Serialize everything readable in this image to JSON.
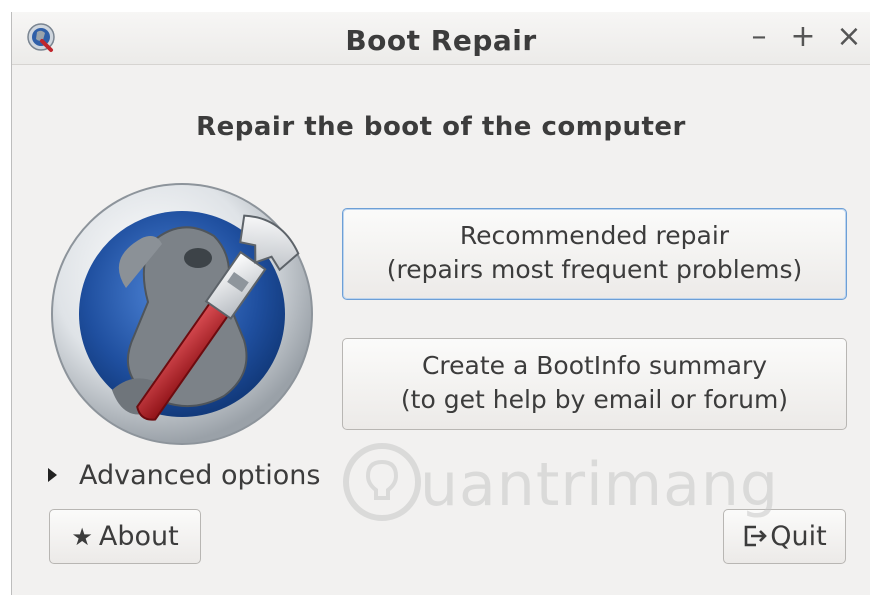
{
  "window": {
    "title": "Boot Repair",
    "controls": {
      "minimize": "–",
      "maximize": "+",
      "close": "×"
    }
  },
  "main": {
    "heading": "Repair the boot of the computer",
    "recommended_repair": {
      "line1": "Recommended repair",
      "line2": "(repairs most frequent problems)"
    },
    "bootinfo_summary": {
      "line1": "Create a BootInfo summary",
      "line2": "(to get help by email or forum)"
    },
    "advanced_options": "Advanced options"
  },
  "footer": {
    "about_label": "About",
    "quit_label": "Quit"
  },
  "icons": {
    "app": "boot-repair-app-icon",
    "logo": "boot-repair-logo",
    "advanced_arrow": "triangle-right-icon",
    "about": "star-icon",
    "quit": "exit-icon"
  },
  "watermark": "uantrimang",
  "colors": {
    "window_bg": "#f2f1f0",
    "text": "#3c3c3c",
    "focus_border": "#6d9fd6",
    "wrench_red": "#c0262d"
  }
}
